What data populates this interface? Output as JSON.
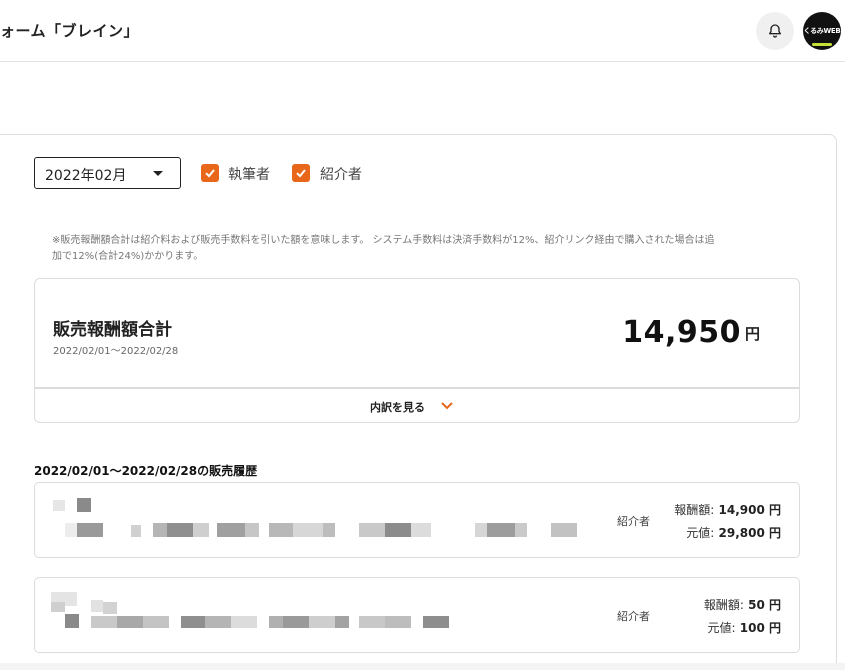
{
  "header": {
    "title": "ォーム「ブレイン」",
    "avatar_text": "くるみWEB"
  },
  "filters": {
    "month": "2022年02月",
    "writer_label": "執筆者",
    "writer_checked": true,
    "referrer_label": "紹介者",
    "referrer_checked": true
  },
  "notice": {
    "line1": "※販売報酬額合計は紹介料および販売手数料を引いた額を意味します。 システム手数料は決済手数料が12%、紹介リンク経由で購入された場合は追",
    "line2": "加で12%(合計24%)かかります。"
  },
  "total": {
    "label": "販売報酬額合計",
    "period": "2022/02/01〜2022/02/28",
    "amount": "14,950",
    "unit": "円"
  },
  "breakdown": {
    "label": "内訳を見る"
  },
  "history": {
    "title": "2022/02/01〜2022/02/28の販売履歴",
    "rows": [
      {
        "role": "紹介者",
        "reward_label": "報酬額:",
        "reward_value": "14,900 円",
        "price_label": "元値:",
        "price_value": "29,800 円"
      },
      {
        "role": "紹介者",
        "reward_label": "報酬額:",
        "reward_value": "50 円",
        "price_label": "元値:",
        "price_value": "100 円"
      }
    ]
  },
  "colors": {
    "accent": "#e8671a",
    "border": "#dcdcdc"
  }
}
